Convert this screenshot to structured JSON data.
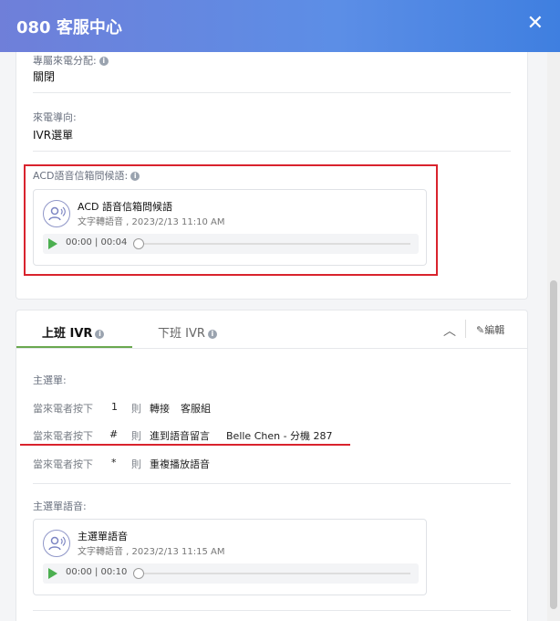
{
  "header": {
    "title": "080 客服中心",
    "close_label": "✕"
  },
  "fields": {
    "exclusive_label": "專屬來電分配:",
    "exclusive_value": "關閉",
    "routing_label": "來電導向:",
    "routing_value": "IVR選單",
    "acd_label": "ACD語音信箱問候語:"
  },
  "acd_audio": {
    "title": "ACD 語音信箱問候語",
    "subtitle": "文字轉語音 , 2023/2/13 11:10 AM",
    "time": "00:00 | 00:04",
    "progress": 0
  },
  "tabs": {
    "work_ivr": "上班 IVR",
    "off_ivr": "下班 IVR",
    "edit": "編輯"
  },
  "menu": {
    "label": "主選單:",
    "rows": [
      {
        "prefix": "當來電者按下",
        "key": "1",
        "then": "則",
        "action": "轉接",
        "target": "客服組"
      },
      {
        "prefix": "當來電者按下",
        "key": "#",
        "then": "則",
        "action": "進到語音留言",
        "target": "Belle Chen - 分機 287"
      },
      {
        "prefix": "當來電者按下",
        "key": "*",
        "then": "則",
        "action": "重複播放語音",
        "target": ""
      }
    ]
  },
  "menu_audio_label": "主選單語音:",
  "menu_audio": {
    "title": "主選單語音",
    "subtitle": "文字轉語音 , 2023/2/13 11:15 AM",
    "time": "00:00 | 00:10",
    "progress": 0
  },
  "colors": {
    "accent": "#3f7fe0",
    "highlight": "#d9232d",
    "play": "#4caf50",
    "active_tab": "#6aa84f"
  }
}
